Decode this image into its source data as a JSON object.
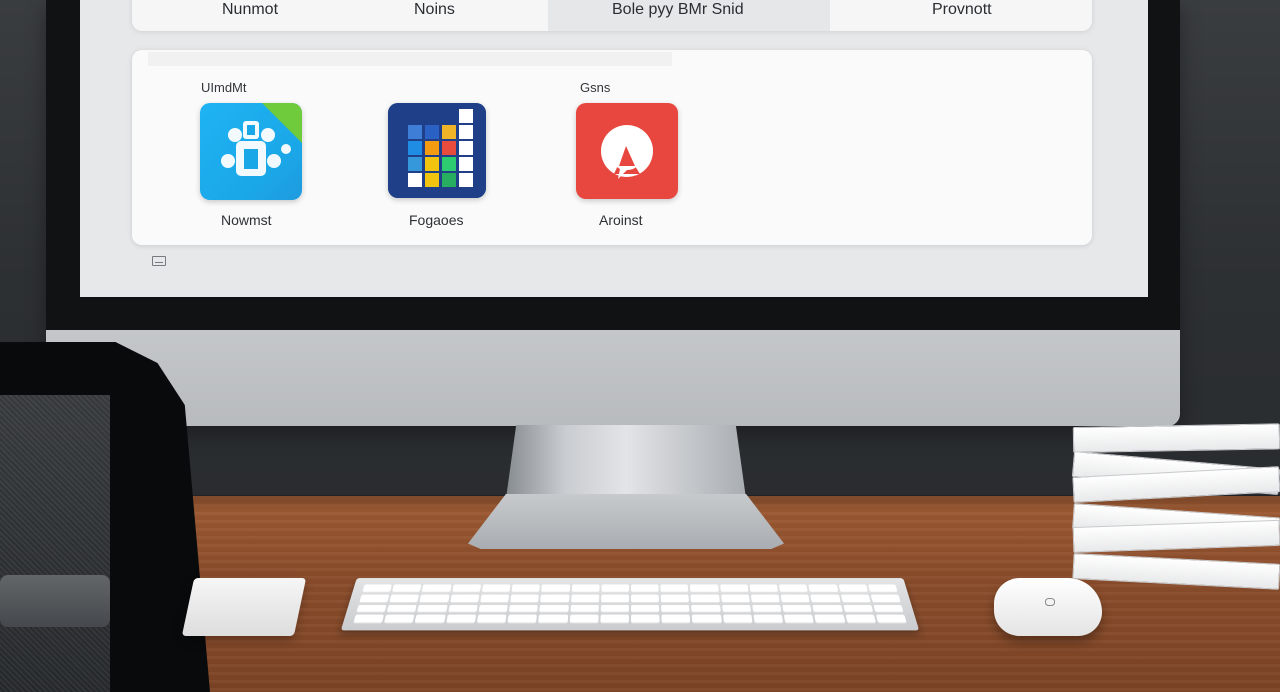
{
  "screen": {
    "top_tabs": [
      {
        "label": "Nunmot"
      },
      {
        "label": "Noins"
      },
      {
        "label": "Bole pyy BMr Snid"
      },
      {
        "label": "Provnott"
      }
    ],
    "section_labels": {
      "left": "UImdMt",
      "right": "Gsns"
    },
    "apps": [
      {
        "label": "Nowmst",
        "icon": "blue-app-icon"
      },
      {
        "label": "Fogaoes",
        "icon": "grid-app-icon"
      },
      {
        "label": "Aroinst",
        "icon": "red-app-icon"
      }
    ],
    "footer_icon": "window-icon"
  },
  "colors": {
    "accent_blue": "#1fb3f3",
    "accent_green": "#6fcb3b",
    "accent_red": "#e8473f",
    "accent_navy": "#1f3f88"
  }
}
